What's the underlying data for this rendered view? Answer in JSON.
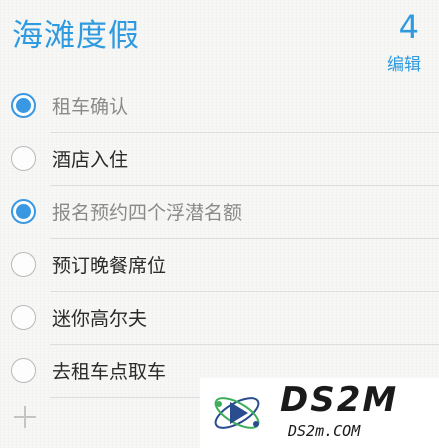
{
  "header": {
    "title": "海滩度假",
    "count": "4",
    "edit_label": "编辑"
  },
  "items": [
    {
      "label": "租车确认",
      "completed": true
    },
    {
      "label": "酒店入住",
      "completed": false
    },
    {
      "label": "报名预约四个浮潜名额",
      "completed": true
    },
    {
      "label": "预订晚餐席位",
      "completed": false
    },
    {
      "label": "迷你高尔夫",
      "completed": false
    },
    {
      "label": "去租车点取车",
      "completed": false
    }
  ],
  "add_icon": "plus-icon",
  "watermark": {
    "brand": "DS2M",
    "site": "DS2m.COM"
  },
  "colors": {
    "accent": "#2e9ae0",
    "checked": "#3a98e3",
    "separator": "#dedede"
  }
}
